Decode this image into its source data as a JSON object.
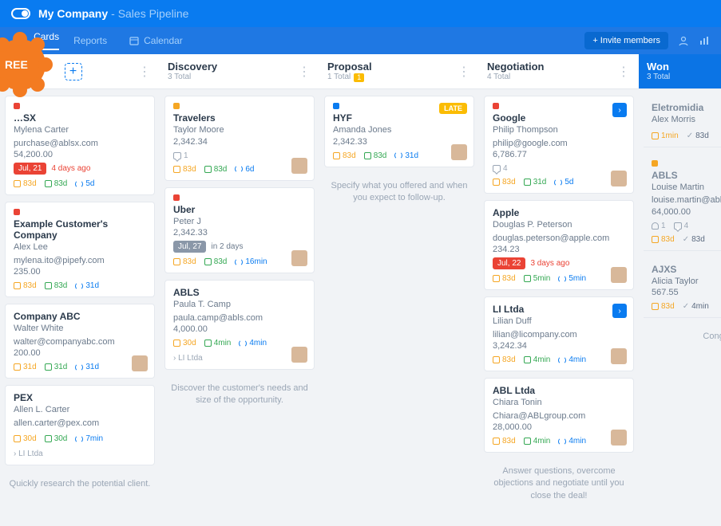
{
  "header": {
    "company": "My Company",
    "pipeline": "Sales Pipeline"
  },
  "nav": {
    "cards": "Cards",
    "reports": "Reports",
    "calendar": "Calendar",
    "invite": "+ Invite members"
  },
  "badge_free": "REE",
  "columns": [
    {
      "title": "",
      "total": "",
      "hint": "Quickly research the potential client.",
      "cards": [
        {
          "dot": "red",
          "title": "…SX",
          "person": "Mylena Carter",
          "email": "purchase@ablsx.com",
          "value": "54,200.00",
          "due_pill": "Jul, 21",
          "due_text": "4 days ago",
          "meta": [
            {
              "t": "o",
              "v": "83d"
            },
            {
              "t": "g",
              "v": "83d"
            },
            {
              "t": "sync",
              "v": "5d"
            }
          ]
        },
        {
          "dot": "red",
          "title": "Example Customer's Company",
          "person": "Alex Lee",
          "email": "mylena.ito@pipefy.com",
          "value": "235.00",
          "meta": [
            {
              "t": "o",
              "v": "83d"
            },
            {
              "t": "g",
              "v": "83d"
            },
            {
              "t": "sync",
              "v": "31d"
            }
          ]
        },
        {
          "dot": "",
          "title": "Company ABC",
          "person": "Walter White",
          "email": "walter@companyabc.com",
          "value": "200.00",
          "meta": [
            {
              "t": "o",
              "v": "31d"
            },
            {
              "t": "g",
              "v": "31d"
            },
            {
              "t": "sync",
              "v": "31d"
            }
          ],
          "avatar": true
        },
        {
          "dot": "",
          "title": "PEX",
          "person": "Allen L. Carter",
          "email": "allen.carter@pex.com",
          "value": "",
          "meta": [
            {
              "t": "o",
              "v": "30d"
            },
            {
              "t": "g",
              "v": "30d"
            },
            {
              "t": "sync",
              "v": "7min"
            }
          ],
          "sub": "LI Ltda"
        }
      ]
    },
    {
      "title": "Discovery",
      "total": "3 Total",
      "hint": "Discover the customer's needs and size of the opportunity.",
      "cards": [
        {
          "dot": "orange",
          "title": "Travelers",
          "person": "Taylor Moore",
          "value": "2,342.34",
          "comment": "1",
          "meta": [
            {
              "t": "o",
              "v": "83d"
            },
            {
              "t": "g",
              "v": "83d"
            },
            {
              "t": "sync",
              "v": "6d"
            }
          ],
          "avatar": true
        },
        {
          "dot": "red",
          "title": "Uber",
          "person": "Peter J",
          "value": "2,342.33",
          "due_pill": "Jul, 27",
          "due_pill_gray": true,
          "due_text": "in 2 days",
          "meta": [
            {
              "t": "o",
              "v": "83d"
            },
            {
              "t": "g",
              "v": "83d"
            },
            {
              "t": "sync",
              "v": "16min"
            }
          ],
          "avatar": true
        },
        {
          "dot": "",
          "title": "ABLS",
          "person": "Paula T. Camp",
          "email": "paula.camp@abls.com",
          "value": "4,000.00",
          "meta": [
            {
              "t": "o",
              "v": "30d"
            },
            {
              "t": "g",
              "v": "4min"
            },
            {
              "t": "sync",
              "v": "4min"
            }
          ],
          "avatar": true,
          "sub": "LI Ltda"
        }
      ]
    },
    {
      "title": "Proposal",
      "total": "1 Total",
      "total_badge": "1",
      "hint": "Specify what you offered and when you expect to follow-up.",
      "cards": [
        {
          "dot": "blue",
          "title": "HYF",
          "person": "Amanda Jones",
          "value": "2,342.33",
          "late": "LATE",
          "meta": [
            {
              "t": "o",
              "v": "83d"
            },
            {
              "t": "g",
              "v": "83d"
            },
            {
              "t": "sync",
              "v": "31d"
            }
          ],
          "avatar": true
        }
      ]
    },
    {
      "title": "Negotiation",
      "total": "4 Total",
      "hint": "Answer questions, overcome objections and negotiate until you close the deal!",
      "cards": [
        {
          "dot": "red",
          "title": "Google",
          "person": "Philip Thompson",
          "email": "philip@google.com",
          "value": "6,786.77",
          "comment": "4",
          "arrow": true,
          "meta": [
            {
              "t": "o",
              "v": "83d"
            },
            {
              "t": "g",
              "v": "31d"
            },
            {
              "t": "sync",
              "v": "5d"
            }
          ],
          "avatar": true
        },
        {
          "dot": "",
          "title": "Apple",
          "person": "Douglas P. Peterson",
          "email": "douglas.peterson@apple.com",
          "value": "234.23",
          "due_pill": "Jul, 22",
          "due_text": "3 days ago",
          "meta": [
            {
              "t": "o",
              "v": "83d"
            },
            {
              "t": "g",
              "v": "5min"
            },
            {
              "t": "sync",
              "v": "5min"
            }
          ],
          "avatar": true
        },
        {
          "dot": "",
          "title": "LI Ltda",
          "person": "Lilian Duff",
          "email": "lilian@licompany.com",
          "value": "3,242.34",
          "arrow": true,
          "meta": [
            {
              "t": "o",
              "v": "83d"
            },
            {
              "t": "g",
              "v": "4min"
            },
            {
              "t": "sync",
              "v": "4min"
            }
          ],
          "avatar": true
        },
        {
          "dot": "",
          "title": "ABL Ltda",
          "person": "Chiara Tonin",
          "email": "Chiara@ABLgroup.com",
          "value": "28,000.00",
          "meta": [
            {
              "t": "o",
              "v": "83d"
            },
            {
              "t": "g",
              "v": "4min"
            },
            {
              "t": "sync",
              "v": "4min"
            }
          ],
          "avatar": true
        }
      ]
    },
    {
      "title": "Won",
      "total": "3 Total",
      "won": true,
      "hint": "Congrat",
      "cards": [
        {
          "dot": "",
          "title": "Eletromidia",
          "person": "Alex Morris",
          "meta": [
            {
              "t": "o",
              "v": "1min"
            },
            {
              "t": "chk",
              "v": "83d"
            }
          ]
        },
        {
          "dot": "orange",
          "title": "ABLS",
          "person": "Louise Martin",
          "email": "louise.martin@abls.c",
          "value": "64,000.00",
          "extra": [
            {
              "t": "person",
              "v": "1"
            },
            {
              "t": "comment",
              "v": "4"
            }
          ],
          "meta": [
            {
              "t": "o",
              "v": "83d"
            },
            {
              "t": "chk",
              "v": "83d"
            }
          ]
        },
        {
          "dot": "",
          "title": "AJXS",
          "person": "Alicia Taylor",
          "value": "567.55",
          "meta": [
            {
              "t": "o",
              "v": "83d"
            },
            {
              "t": "chk",
              "v": "4min"
            }
          ]
        }
      ]
    }
  ]
}
